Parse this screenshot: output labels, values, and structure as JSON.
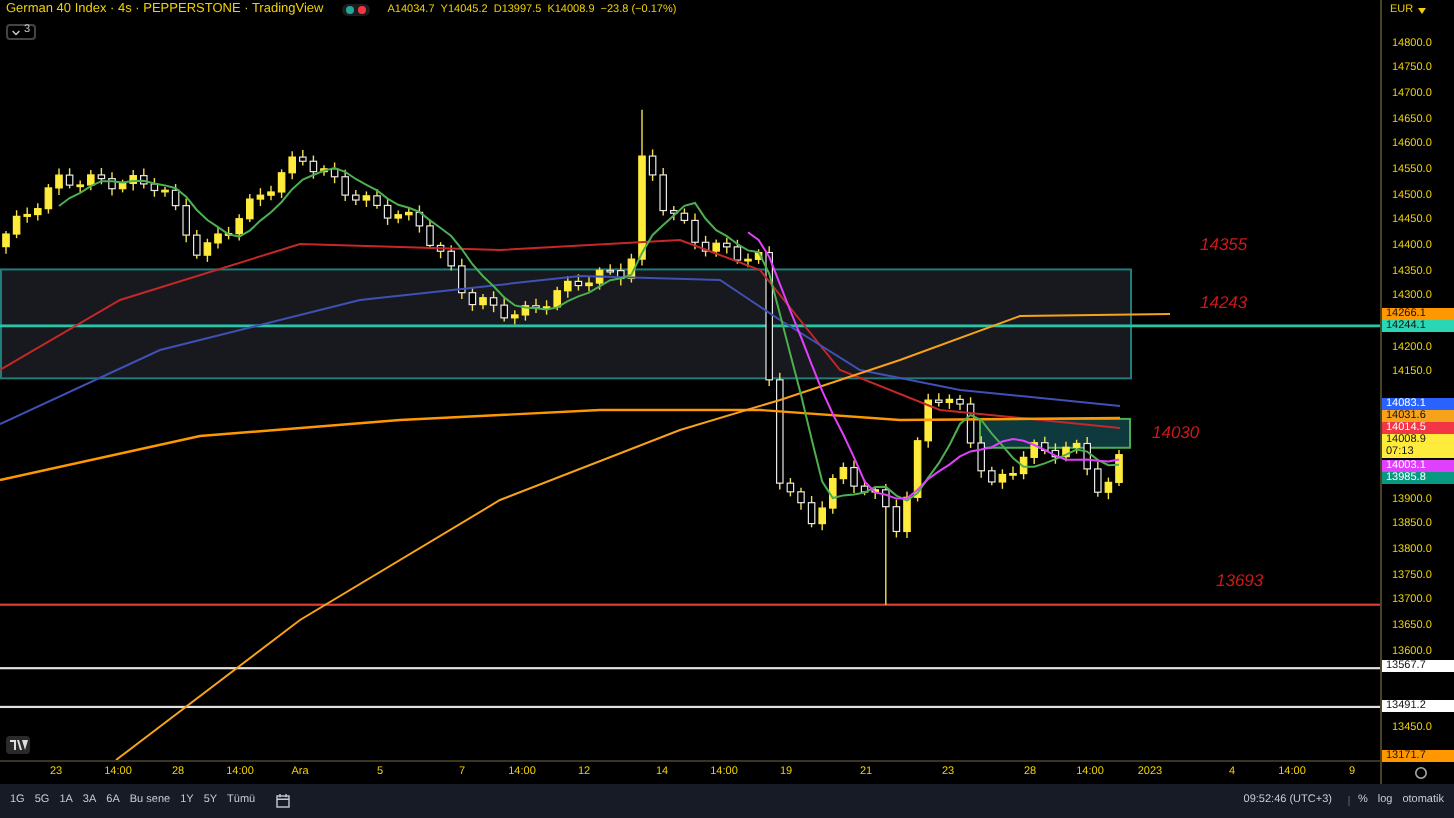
{
  "header": {
    "title": "German 40 Index · 4s · PEPPERSTONE · TradingView",
    "status_dots": [
      {
        "color": "#26a69a"
      },
      {
        "color": "#f23645"
      }
    ],
    "ohlc": [
      {
        "key": "A",
        "value": "14034.7"
      },
      {
        "key": "Y",
        "value": "14045.2"
      },
      {
        "key": "D",
        "value": "13997.5"
      },
      {
        "key": "K",
        "value": "14008.9"
      }
    ],
    "change": "−23.8 (−0.17%)",
    "indicators_count": "3"
  },
  "chart": {
    "annotations": [
      "14355",
      "14243",
      "14030",
      "13693"
    ],
    "levels": [
      {
        "color": "#26c6a6"
      },
      {
        "color": "#e53935"
      },
      {
        "color": "#e0e0e0"
      },
      {
        "color": "#e0e0e0"
      }
    ]
  },
  "price_axis": {
    "currency": "EUR",
    "ticks": [
      "14800.0",
      "14750.0",
      "14700.0",
      "14650.0",
      "14600.0",
      "14550.0",
      "14500.0",
      "14450.0",
      "14400.0",
      "14350.0",
      "14300.0",
      "14200.0",
      "14150.0",
      "13900.0",
      "13850.0",
      "13800.0",
      "13750.0",
      "13700.0",
      "13650.0",
      "13600.0",
      "13450.0"
    ],
    "badges": [
      {
        "value": "14266.1",
        "color": "#ff9800"
      },
      {
        "value": "14244.1",
        "color": "#2bd6b4"
      },
      {
        "value": "14083.1",
        "color": "#2962ff"
      },
      {
        "value": "14031.6",
        "color": "#f7a21b"
      },
      {
        "value": "14014.5",
        "color": "#f23645"
      },
      {
        "value": "14008.9",
        "sub": "07:13",
        "color": "#ffeb3b"
      },
      {
        "value": "14003.1",
        "color": "#e040fb"
      },
      {
        "value": "13985.8",
        "color": "#089981"
      },
      {
        "value": "13567.7",
        "color": "#ffffff"
      },
      {
        "value": "13491.2",
        "color": "#ffffff"
      },
      {
        "value": "13171.7",
        "color": "#ff9800"
      }
    ]
  },
  "time_axis": [
    "23",
    "14:00",
    "28",
    "14:00",
    "Ara",
    "5",
    "7",
    "14:00",
    "12",
    "14",
    "14:00",
    "19",
    "21",
    "23",
    "28",
    "14:00",
    "2023",
    "4",
    "14:00",
    "9"
  ],
  "bottom_bar": {
    "ranges": [
      "1G",
      "5G",
      "1A",
      "3A",
      "6A",
      "Bu sene",
      "1Y",
      "5Y",
      "Tümü"
    ],
    "clock": "09:52:46 (UTC+3)",
    "options": [
      "%",
      "log",
      "otomatik"
    ]
  }
}
